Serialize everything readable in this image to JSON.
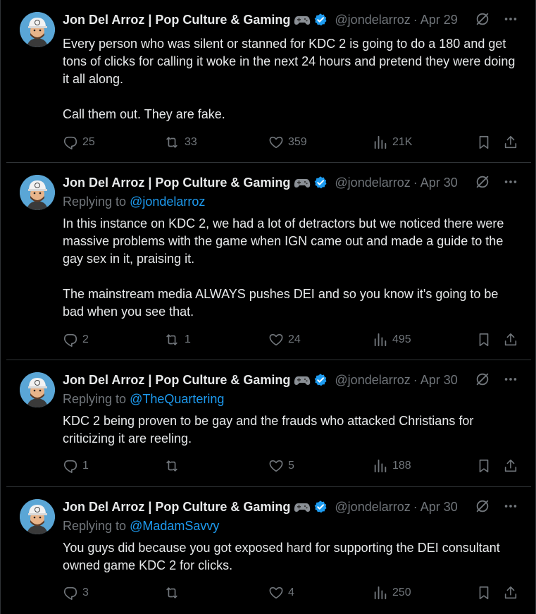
{
  "colors": {
    "background": "#000000",
    "text": "#e7e9ea",
    "muted": "#71767b",
    "accent": "#1d9bf0",
    "border": "#2f3336"
  },
  "author": {
    "name": "Jon Del Arroz | Pop Culture & Gaming",
    "handle": "@jondelarroz",
    "badges": [
      "game-controller-icon",
      "verified-badge-icon"
    ]
  },
  "tweets": [
    {
      "date": "Apr 29",
      "reply_prefix": "",
      "reply_to": "",
      "text": "Every person who was silent or stanned for KDC 2 is going to do a 180 and get tons of clicks for calling it woke in the next 24 hours and pretend they were doing it all along.\n\nCall them out. They are fake.",
      "replies": "25",
      "reposts": "33",
      "likes": "359",
      "views": "21K"
    },
    {
      "date": "Apr 30",
      "reply_prefix": "Replying to ",
      "reply_to": "@jondelarroz",
      "text": "In this instance on KDC 2, we had a lot of detractors but we noticed there were massive problems with the game when IGN came out and made a guide to the gay sex in it, praising it.\n\nThe mainstream media ALWAYS pushes DEI and so you know it's going to be bad when you see that.",
      "replies": "2",
      "reposts": "1",
      "likes": "24",
      "views": "495"
    },
    {
      "date": "Apr 30",
      "reply_prefix": "Replying to ",
      "reply_to": "@TheQuartering",
      "text": "KDC 2 being proven to be gay and the frauds who attacked Christians for criticizing it are reeling.",
      "replies": "1",
      "reposts": "",
      "likes": "5",
      "views": "188"
    },
    {
      "date": "Apr 30",
      "reply_prefix": "Replying to ",
      "reply_to": "@MadamSavvy",
      "text": "You guys did because you got exposed hard for supporting the DEI consultant owned game KDC 2 for clicks.",
      "replies": "3",
      "reposts": "",
      "likes": "4",
      "views": "250"
    }
  ]
}
